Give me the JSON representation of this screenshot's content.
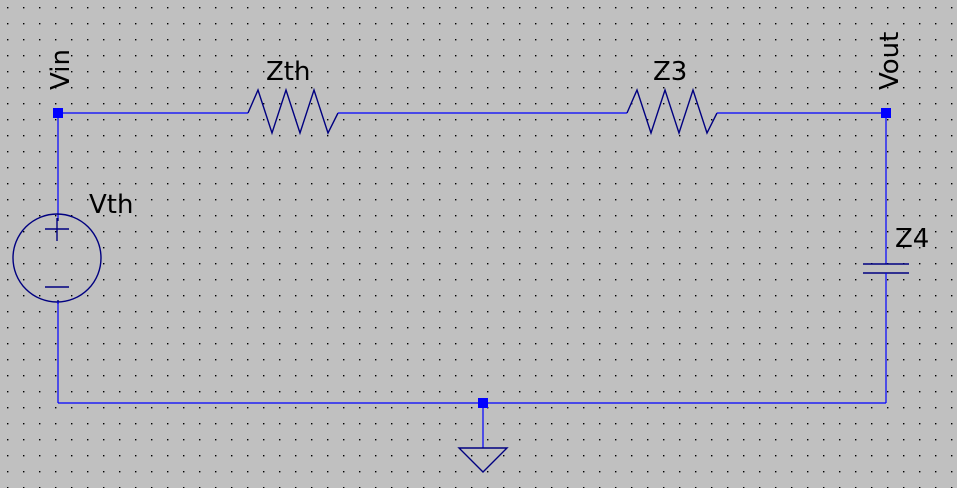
{
  "colors": {
    "background": "#c0c0c0",
    "grid_dot": "#000000",
    "wire": "#0000ff",
    "component": "#000080",
    "junction": "#0000ff",
    "text": "#000000"
  },
  "labels": {
    "vin": "Vin",
    "vout": "Vout",
    "vth": "Vth",
    "zth": "Zth",
    "z3": "Z3",
    "z4": "Z4"
  },
  "source_symbols": {
    "plus": "+",
    "minus": "−"
  }
}
